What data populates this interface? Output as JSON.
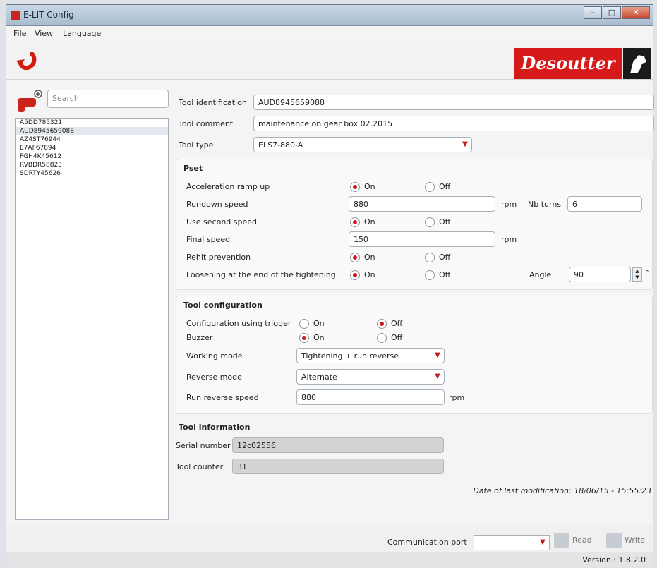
{
  "window": {
    "title": "E-LIT Config"
  },
  "menu": [
    "File",
    "View",
    "Language"
  ],
  "brand": {
    "name": "Desoutter",
    "color": "#d61a1a"
  },
  "search": {
    "placeholder": "Search"
  },
  "tools": [
    "A5DD785321",
    "AUD8945659088",
    "AZ4ST76944",
    "E7AF67894",
    "FGH4K45612",
    "RVBDR58823",
    "SDRTY45626"
  ],
  "selected_tool_index": 1,
  "identification": {
    "tool_id_label": "Tool identification",
    "tool_id": "AUD8945659088",
    "comment_label": "Tool comment",
    "comment": "maintenance on gear box 02.2015",
    "type_label": "Tool type",
    "type": "ELS7-880-A"
  },
  "pset": {
    "title": "Pset",
    "accel_label": "Acceleration ramp up",
    "accel": "On",
    "rundown_label": "Rundown speed",
    "rundown": "880",
    "rpm": "rpm",
    "nb_turns_label": "Nb turns",
    "nb_turns": "6",
    "second_label": "Use second speed",
    "second": "On",
    "final_label": "Final speed",
    "final": "150",
    "rehit_label": "Rehit prevention",
    "rehit": "On",
    "loosen_label": "Loosening at the end of the tightening",
    "loosen": "On",
    "angle_label": "Angle",
    "angle": "90",
    "degree": "°"
  },
  "config": {
    "title": "Tool configuration",
    "trigger_label": "Configuration using trigger",
    "trigger": "Off",
    "buzzer_label": "Buzzer",
    "buzzer": "On",
    "mode_label": "Working mode",
    "mode": "Tightening + run reverse",
    "reverse_label": "Reverse mode",
    "reverse": "Alternate",
    "run_speed_label": "Run reverse speed",
    "run_speed": "880",
    "rpm": "rpm"
  },
  "info": {
    "title": "Tool information",
    "serial_label": "Serial number",
    "serial": "12c02556",
    "counter_label": "Tool counter",
    "counter": "31"
  },
  "options": {
    "on": "On",
    "off": "Off"
  },
  "last_mod": "Date of last modification:  18/06/15 - 15:55:23",
  "comm_label": "Communication port",
  "read_label": "Read",
  "write_label": "Write",
  "version": "Version : 1.8.2.0"
}
